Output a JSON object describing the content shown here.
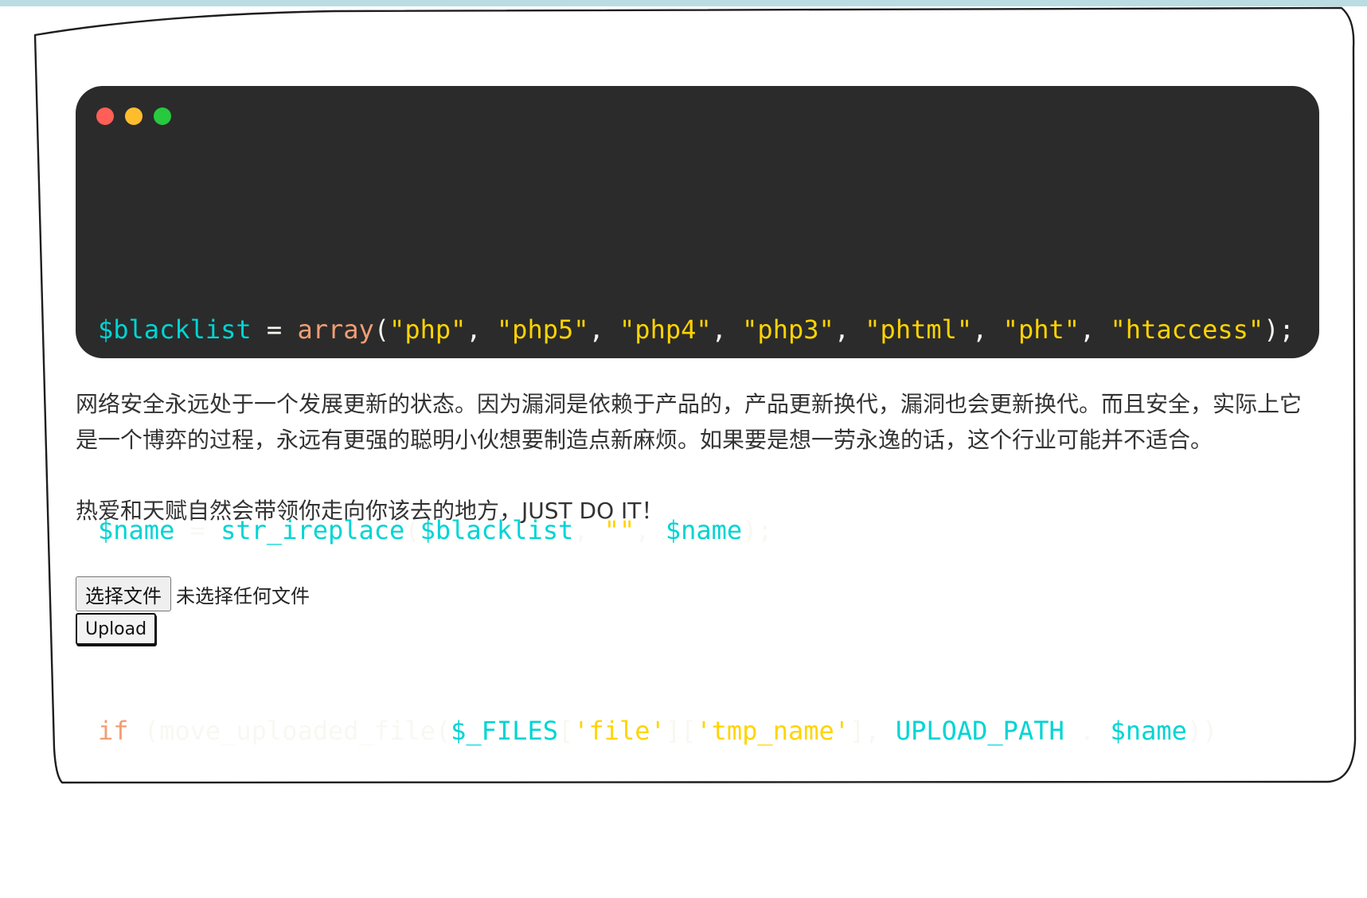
{
  "colors": {
    "code_background": "#2b2b2b",
    "dot_red": "#ff5f56",
    "dot_yellow": "#ffbd2e",
    "dot_green": "#27c93f",
    "variable": "#00d4d4",
    "function": "#f29e74",
    "string": "#ffd400",
    "top_strip": "#b9dde3"
  },
  "code": {
    "line1": {
      "var": "$blacklist",
      "op": " = ",
      "fn": "array",
      "open": "(",
      "s1": "\"php\"",
      "c1": ", ",
      "s2": "\"php5\"",
      "c2": ", ",
      "s3": "\"php4\"",
      "c3": ", ",
      "s4": "\"php3\"",
      "c4": ", ",
      "s5": "\"phtml\"",
      "c5": ", ",
      "s6": "\"pht\"",
      "c6": ", ",
      "s7": "\"htaccess\"",
      "close": ");"
    },
    "line2": {
      "var": "$name",
      "op": " = ",
      "fn": "str_ireplace",
      "open": "(",
      "arg1": "$blacklist",
      "c1": ", ",
      "arg2": "\"\"",
      "c2": ", ",
      "arg3": "$name",
      "close": ");"
    },
    "line3": {
      "kw": "if",
      "sp": " ",
      "open": "(move_uploaded_file(",
      "files": "$_FILES",
      "b1": "[",
      "key1": "'file'",
      "b2": "][",
      "key2": "'tmp_name'",
      "b3": "], ",
      "const": "UPLOAD_PATH",
      "dot": " . ",
      "var": "$name",
      "close": "))"
    }
  },
  "text": {
    "paragraph1": "网络安全永远处于一个发展更新的状态。因为漏洞是依赖于产品的，产品更新换代，漏洞也会更新换代。而且安全，实际上它是一个博弈的过程，永远有更强的聪明小伙想要制造点新麻烦。如果要是想一劳永逸的话，这个行业可能并不适合。",
    "paragraph2": "热爱和天赋自然会带领你走向你该去的地方，JUST DO IT！"
  },
  "form": {
    "choose_file_label": "选择文件",
    "no_file_text": "未选择任何文件",
    "upload_label": "Upload"
  }
}
